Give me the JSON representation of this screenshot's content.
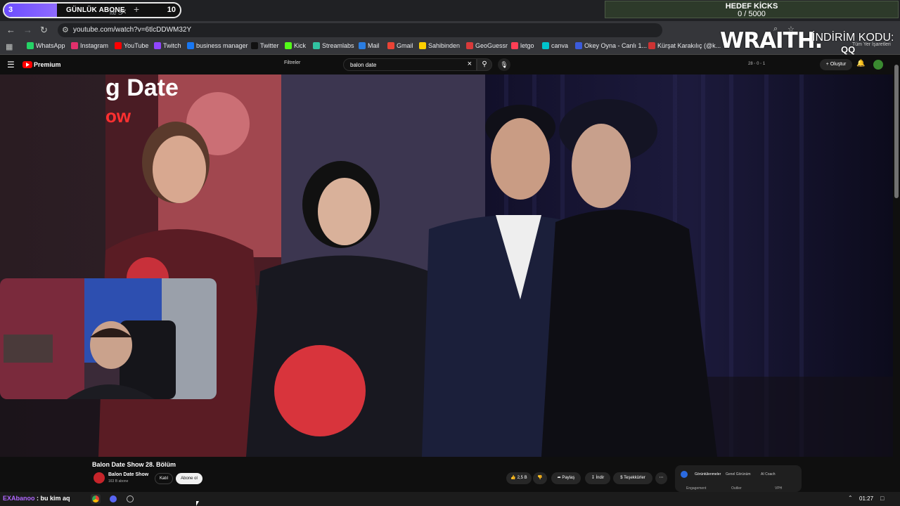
{
  "stream_overlay": {
    "goal_count": "3",
    "goal_label": "GÜNLÜK ABONE",
    "goal_target": "10",
    "goal_progress": 0.3,
    "kicks_label": "HEDEF KİCKS",
    "kicks_value": "0 / 5000",
    "sponsor": "WRAITH.",
    "promo_label": "İNDİRİM KODU:",
    "promo_code": "QQ"
  },
  "browser": {
    "tab_ghost": "ite S",
    "tab_close": "✕",
    "new_tab": "+",
    "url": "youtube.com/watch?v=6tlcDDWM32Y",
    "bookmarks": [
      {
        "label": "WhatsApp",
        "color": "#25d366"
      },
      {
        "label": "Instagram",
        "color": "#e1306c"
      },
      {
        "label": "YouTube",
        "color": "#ff0000"
      },
      {
        "label": "Twitch",
        "color": "#9146ff"
      },
      {
        "label": "business manager",
        "color": "#1877f2"
      },
      {
        "label": "Twitter",
        "color": "#111111"
      },
      {
        "label": "Kick",
        "color": "#53fc18"
      },
      {
        "label": "Streamlabs",
        "color": "#31c3a2"
      },
      {
        "label": "Mail",
        "color": "#2a7de1"
      },
      {
        "label": "Gmail",
        "color": "#ea4335"
      },
      {
        "label": "Sahibinden",
        "color": "#ffd000"
      },
      {
        "label": "GeoGuessr",
        "color": "#d83a3a"
      },
      {
        "label": "letgo",
        "color": "#ff3f55"
      },
      {
        "label": "canva",
        "color": "#00c4cc"
      },
      {
        "label": "Okey Oyna - Canlı 1...",
        "color": "#3b5bdb"
      },
      {
        "label": "Kürşat Karakılıç (@k...",
        "color": "#cc3333"
      }
    ],
    "bookmarks_overflow": "»",
    "other_bookmarks": "Tüm Yer İşaretleri"
  },
  "youtube": {
    "brand": "Premium",
    "filters": "Filtreler",
    "search_query": "balon date",
    "ext_stats": "28 ◦ 0 ◦ 1",
    "create": "+ Oluştur",
    "video_title": "Balon Date Show 28. Bölüm",
    "channel_name": "Balon Date Show",
    "channel_subs": "163 B abone",
    "join": "Katıl",
    "subscribe": "Abone ol",
    "likes": "2,5 B",
    "share": "Paylaş",
    "download": "İndir",
    "thanks": "Teşekkürler",
    "more": "⋯",
    "ext_tabs": [
      "Görüntülenmeler",
      "Genel Görünüm",
      "AI Coach"
    ],
    "ext_cols": [
      "Engagement",
      "Outlier",
      "VPH"
    ],
    "show_logo_line1": "g Date",
    "show_logo_line2": "ow"
  },
  "taskbar": {
    "chat_user": "EXAbanoo",
    "chat_msg": ": bu kim aq",
    "clock": "01:27"
  }
}
